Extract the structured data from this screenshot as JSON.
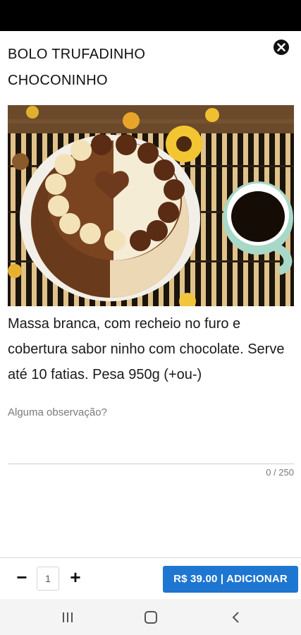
{
  "header": {
    "title": "BOLO TRUFADINHO CHOCONINHO",
    "close_icon": "close-circle-icon"
  },
  "product": {
    "image": "cake-photo",
    "description": "Massa branca, com recheio no furo e cobertura sabor ninho com chocolate. Serve até 10 fatias. Pesa 950g (+ou-)"
  },
  "notes": {
    "placeholder": "Alguma observação?",
    "value": "",
    "counter": "0 / 250"
  },
  "order": {
    "minus_label": "−",
    "quantity": "1",
    "plus_label": "+",
    "add_label": "R$ 39.00 | ADICIONAR"
  },
  "colors": {
    "accent": "#1e76d0",
    "status_bar": "#000000",
    "nav_bar": "#f4f4f4"
  },
  "nav": {
    "recents_icon": "recents-icon",
    "home_icon": "home-icon",
    "back_icon": "back-icon"
  }
}
